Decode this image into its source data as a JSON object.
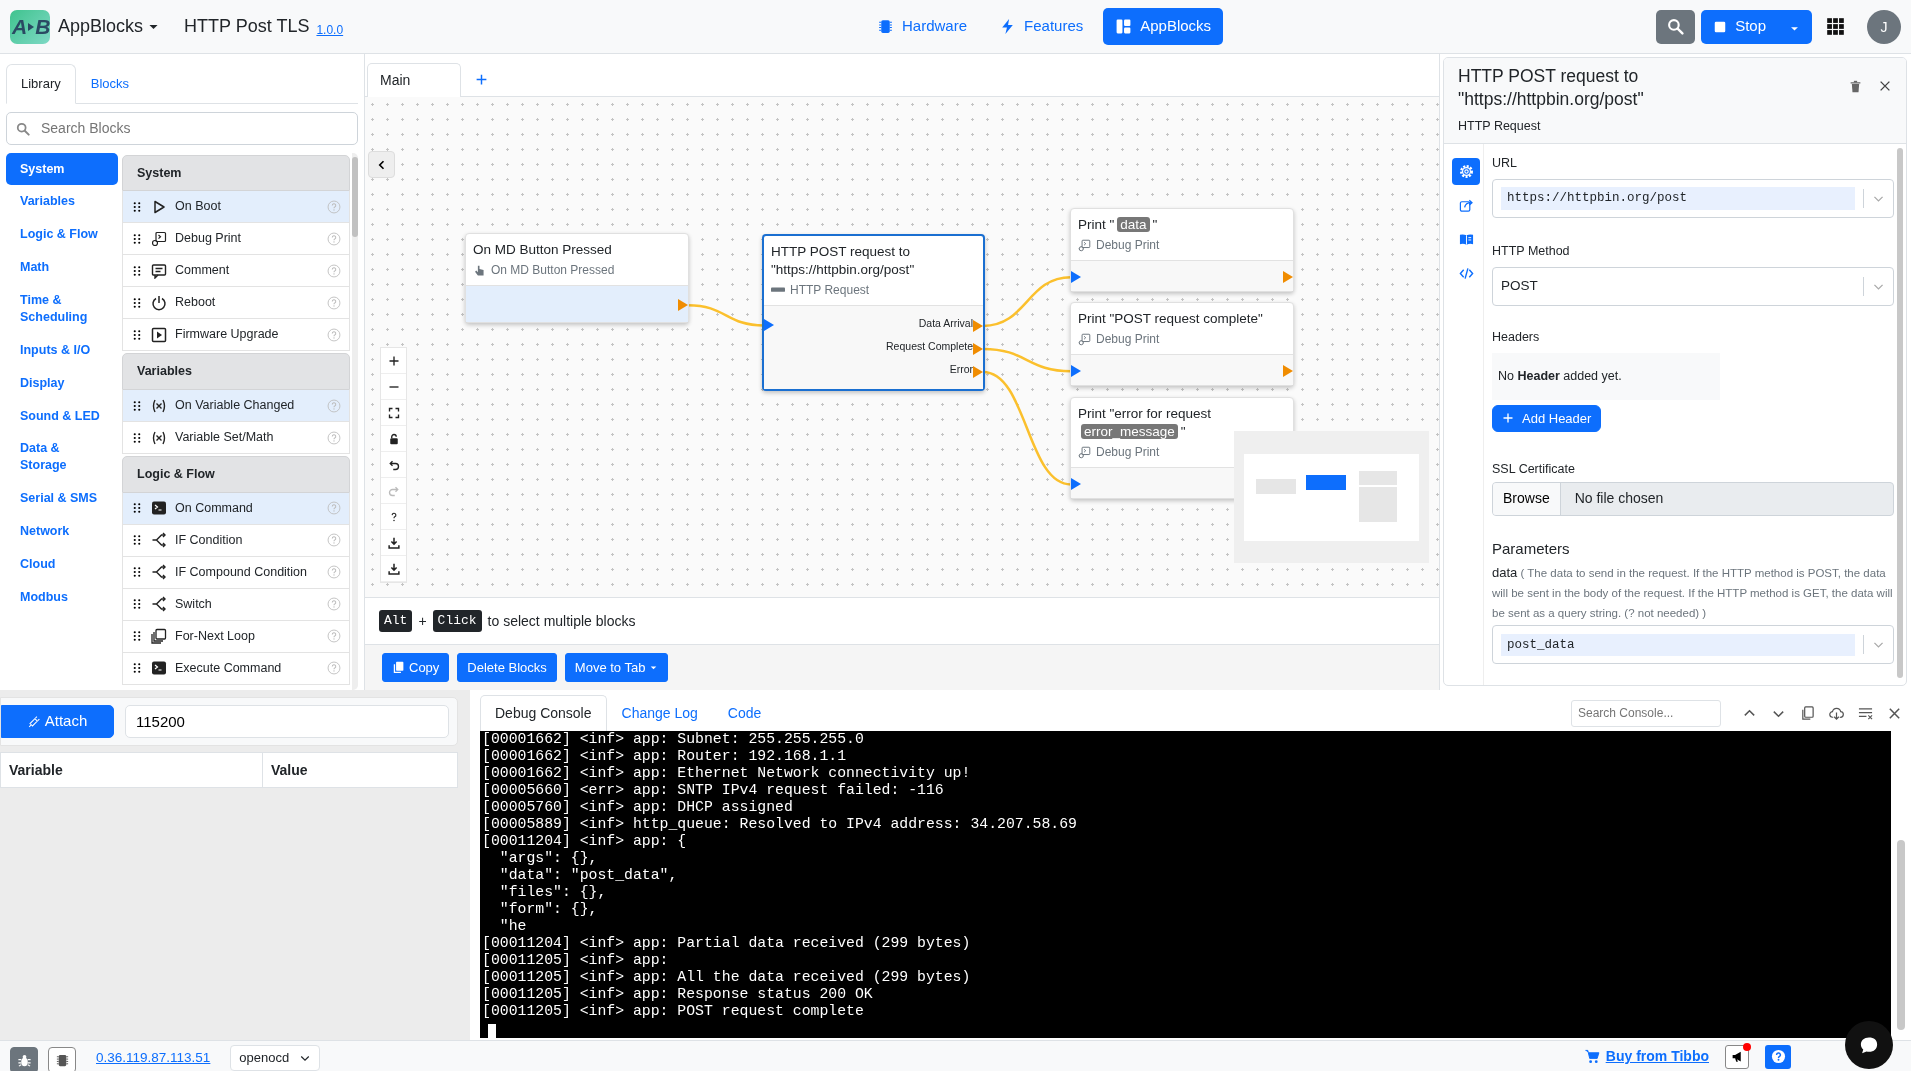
{
  "app": {
    "logo": {
      "left": "A",
      "right": "B"
    },
    "name": "AppBlocks",
    "project": "HTTP Post TLS",
    "version": "1.0.0"
  },
  "top_nav": [
    {
      "label": "Hardware",
      "selected": false
    },
    {
      "label": "Features",
      "selected": false
    },
    {
      "label": "AppBlocks",
      "selected": true
    }
  ],
  "toolbar": {
    "run_button": "Stop",
    "avatar": "J"
  },
  "library": {
    "tabs": [
      {
        "label": "Library",
        "selected": true
      },
      {
        "label": "Blocks",
        "selected": false
      }
    ],
    "search": {
      "placeholder": "Search Blocks"
    },
    "categories": [
      {
        "label": "System",
        "selected": true
      },
      {
        "label": "Variables",
        "selected": false
      },
      {
        "label": "Logic & Flow",
        "selected": false
      },
      {
        "label": "Math",
        "selected": false
      },
      {
        "label": "Time & Scheduling",
        "selected": false
      },
      {
        "label": "Inputs & I/O",
        "selected": false
      },
      {
        "label": "Display",
        "selected": false
      },
      {
        "label": "Sound & LED",
        "selected": false
      },
      {
        "label": "Data & Storage",
        "selected": false
      },
      {
        "label": "Serial & SMS",
        "selected": false
      },
      {
        "label": "Network",
        "selected": false
      },
      {
        "label": "Cloud",
        "selected": false
      },
      {
        "label": "Modbus",
        "selected": false
      }
    ],
    "groups": [
      {
        "title": "System",
        "items": [
          {
            "label": "On Boot",
            "kind": "event"
          },
          {
            "label": "Debug Print",
            "kind": "action"
          },
          {
            "label": "Comment",
            "kind": "action"
          },
          {
            "label": "Reboot",
            "kind": "action"
          },
          {
            "label": "Firmware Upgrade",
            "kind": "action"
          }
        ]
      },
      {
        "title": "Variables",
        "items": [
          {
            "label": "On Variable Changed",
            "kind": "event"
          },
          {
            "label": "Variable Set/Math",
            "kind": "action"
          }
        ]
      },
      {
        "title": "Logic & Flow",
        "items": [
          {
            "label": "On Command",
            "kind": "event"
          },
          {
            "label": "IF Condition",
            "kind": "action"
          },
          {
            "label": "IF Compound Condition",
            "kind": "action"
          },
          {
            "label": "Switch",
            "kind": "action"
          },
          {
            "label": "For-Next Loop",
            "kind": "action"
          },
          {
            "label": "Execute Command",
            "kind": "action"
          }
        ]
      }
    ]
  },
  "canvas": {
    "tabs": [
      {
        "label": "Main",
        "selected": true
      }
    ],
    "nodes": [
      {
        "kind": "event",
        "title": [
          {
            "text": "On MD Button Pressed"
          }
        ],
        "subtitle": "On MD Button Pressed",
        "selected": false
      },
      {
        "kind": "request",
        "title": [
          {
            "text": "HTTP POST request to \"https://httpbin.org/post\""
          }
        ],
        "subtitle": "HTTP Request",
        "selected": true,
        "outputs": [
          "Data Arrival",
          "Request Complete",
          "Error"
        ]
      },
      {
        "kind": "print",
        "title": [
          {
            "text": "Print \""
          },
          {
            "text": "data",
            "variable": true
          },
          {
            "text": "\""
          }
        ],
        "subtitle": "Debug Print",
        "selected": false,
        "has_output": true
      },
      {
        "kind": "print",
        "title": [
          {
            "text": "Print \"POST request complete\""
          }
        ],
        "subtitle": "Debug Print",
        "selected": false,
        "has_output": true
      },
      {
        "kind": "print",
        "title": [
          {
            "text": "Print \"error for request "
          },
          {
            "text": "error_message",
            "variable": true
          },
          {
            "text": "\""
          }
        ],
        "subtitle": "Debug Print",
        "selected": false,
        "has_output": false
      }
    ],
    "hint": {
      "keys": [
        "Alt",
        "Click"
      ],
      "joiner": "+",
      "text": "to select multiple blocks"
    },
    "actions": [
      {
        "label": "Copy",
        "kind": "copy"
      },
      {
        "label": "Delete Blocks",
        "kind": "plain"
      },
      {
        "label": "Move to Tab",
        "kind": "dropdown"
      }
    ]
  },
  "inspector": {
    "title": "HTTP POST request to \"https://httpbin.org/post\"",
    "subtitle": "HTTP Request",
    "side_tabs": [
      {
        "selected": true
      },
      {
        "selected": false
      },
      {
        "selected": false
      },
      {
        "selected": false
      }
    ],
    "url": {
      "label": "URL",
      "value": "https://httpbin.org/post"
    },
    "method": {
      "label": "HTTP Method",
      "value": "POST"
    },
    "headers": {
      "label": "Headers",
      "empty": "No **Header** added yet.",
      "add_button": "Add Header"
    },
    "ssl": {
      "label": "SSL Certificate",
      "button": "Browse",
      "value": "No file chosen"
    },
    "parameters": {
      "title": "Parameters",
      "name": "data",
      "description": "( The data to send in the request. If the HTTP method is POST, the data will be sent in the body of the request. If the HTTP method is GET, the data will be sent as a query string. (? not needed) )",
      "value": "post_data"
    }
  },
  "debugger": {
    "attach_button": "Attach",
    "baud": "115200",
    "columns": [
      "Variable",
      "Value"
    ]
  },
  "console": {
    "tabs": [
      {
        "label": "Debug Console",
        "selected": true
      },
      {
        "label": "Change Log",
        "selected": false
      },
      {
        "label": "Code",
        "selected": false
      }
    ],
    "search": {
      "placeholder": "Search Console..."
    },
    "lines": [
      "[00001662] <inf> app: Subnet: 255.255.255.0",
      "[00001662] <inf> app: Router: 192.168.1.1",
      "[00001662] <inf> app: Ethernet Network connectivity up!",
      "[00005660] <err> app: SNTP IPv4 request failed: -116",
      "[00005760] <inf> app: DHCP assigned",
      "[00005889] <inf> http_queue: Resolved to IPv4 address: 34.207.58.69",
      "[00011204] <inf> app: {",
      "  \"args\": {},",
      "  \"data\": \"post_data\",",
      "  \"files\": {},",
      "  \"form\": {},",
      "  \"he",
      "[00011204] <inf> app: Partial data received (299 bytes)",
      "[00011205] <inf> app: ",
      "[00011205] <inf> app: All the data received (299 bytes)",
      "[00011205] <inf> app: Response status 200 OK",
      "[00011205] <inf> app: POST request complete"
    ]
  },
  "footer": {
    "tool_buttons": [
      {
        "selected": true
      },
      {
        "selected": false
      }
    ],
    "address": "0.36.119.87.113.51",
    "target": "openocd",
    "buy_link": "Buy from Tibbo",
    "notification": true
  }
}
